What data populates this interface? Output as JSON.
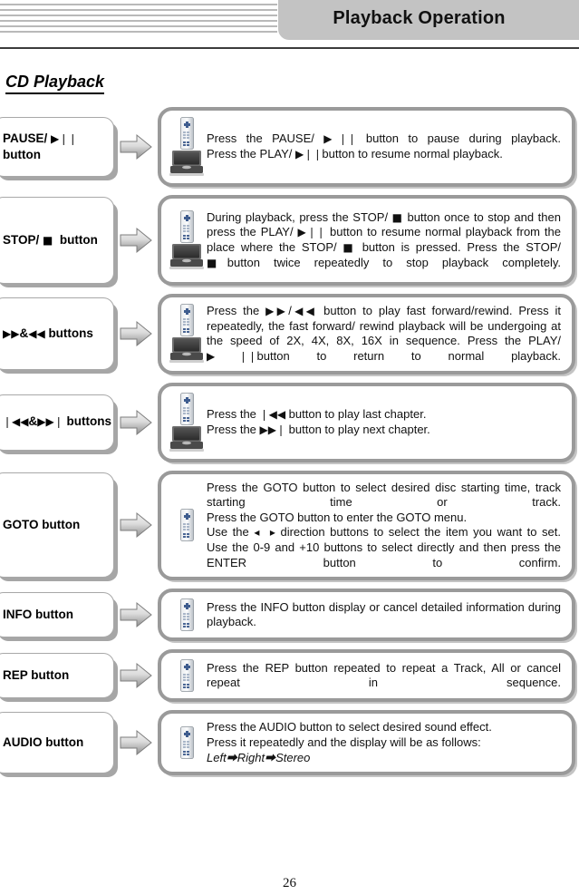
{
  "header": {
    "title": "Playback Operation",
    "decor_line_count": 6,
    "title_bg": "#c3c3c3",
    "rule_color": "#3c3c3c"
  },
  "section": {
    "title": "CD Playback"
  },
  "footer": {
    "page_number": "26"
  },
  "icons": {
    "remote": "remote-control-icon",
    "player": "portable-dvd-player-icon",
    "arrow": "right-arrow-icon"
  },
  "rows": [
    {
      "id": "pause",
      "label": "PAUSE/ ▶❙❙ button",
      "label_plain": "PAUSE/ button",
      "icons": [
        "remote-control-icon",
        "portable-dvd-player-icon"
      ],
      "lines": [
        "Press the PAUSE/ ▶❙❙ button to pause during playback.",
        "Press the PLAY/ ▶❙❙ button to resume normal playback."
      ]
    },
    {
      "id": "stop",
      "label": "STOP/ ■  button",
      "label_plain": "STOP/ button",
      "icons": [
        "remote-control-icon",
        "portable-dvd-player-icon"
      ],
      "lines": [
        "During playback, press the STOP/ ■ button once to stop and then press the PLAY/ ▶❙❙ button to resume normal playback from the place where the STOP/ ■ button is pressed. Press the STOP/ ■ button twice repeatedly to stop playback completely."
      ]
    },
    {
      "id": "fast-forward-rewind",
      "label": "▶▶&◀◀ buttons",
      "label_plain": "fast forward & rewind buttons",
      "icons": [
        "remote-control-icon",
        "portable-dvd-player-icon"
      ],
      "lines": [
        "Press the ▶▶/◀◀ button to play fast forward/rewind. Press it repeatedly, the fast forward/ rewind playback will be undergoing at the speed of 2X, 4X, 8X, 16X in sequence. Press the PLAY/ ▶❙❙ button to return to normal playback."
      ]
    },
    {
      "id": "skip",
      "label": "❙◀◀&▶▶❙ buttons",
      "label_plain": "previous & next chapter buttons",
      "icons": [
        "remote-control-icon",
        "portable-dvd-player-icon"
      ],
      "lines": [
        "Press the ❙◀◀ button to play last chapter.",
        "Press the ▶▶❙ button to play next chapter."
      ]
    },
    {
      "id": "goto",
      "label": "GOTO button",
      "label_plain": "GOTO button",
      "icons": [
        "remote-control-icon"
      ],
      "lines": [
        "Press the GOTO button to select desired disc starting time, track starting time or track.",
        "Press the GOTO button to enter the GOTO menu.",
        "Use the ◂  ▸ direction buttons to select the item you want to set.",
        "Use the 0-9 and +10 buttons to select directly and then press the ENTER button to confirm."
      ]
    },
    {
      "id": "info",
      "label": "INFO button",
      "label_plain": "INFO button",
      "icons": [
        "remote-control-icon"
      ],
      "lines": [
        "Press the INFO button display or cancel detailed information during playback."
      ]
    },
    {
      "id": "rep",
      "label": "REP button",
      "label_plain": "REP button",
      "icons": [
        "remote-control-icon"
      ],
      "lines": [
        "Press the REP button repeated to repeat a Track, All or cancel repeat in sequence."
      ]
    },
    {
      "id": "audio",
      "label": "AUDIO button",
      "label_plain": "AUDIO button",
      "icons": [
        "remote-control-icon"
      ],
      "lines": [
        "Press the AUDIO button to select desired sound effect.",
        "Press it repeatedly and the display will be as follows:",
        "Left—▶Right—▶Stereo"
      ],
      "last_line_italic": true
    }
  ]
}
